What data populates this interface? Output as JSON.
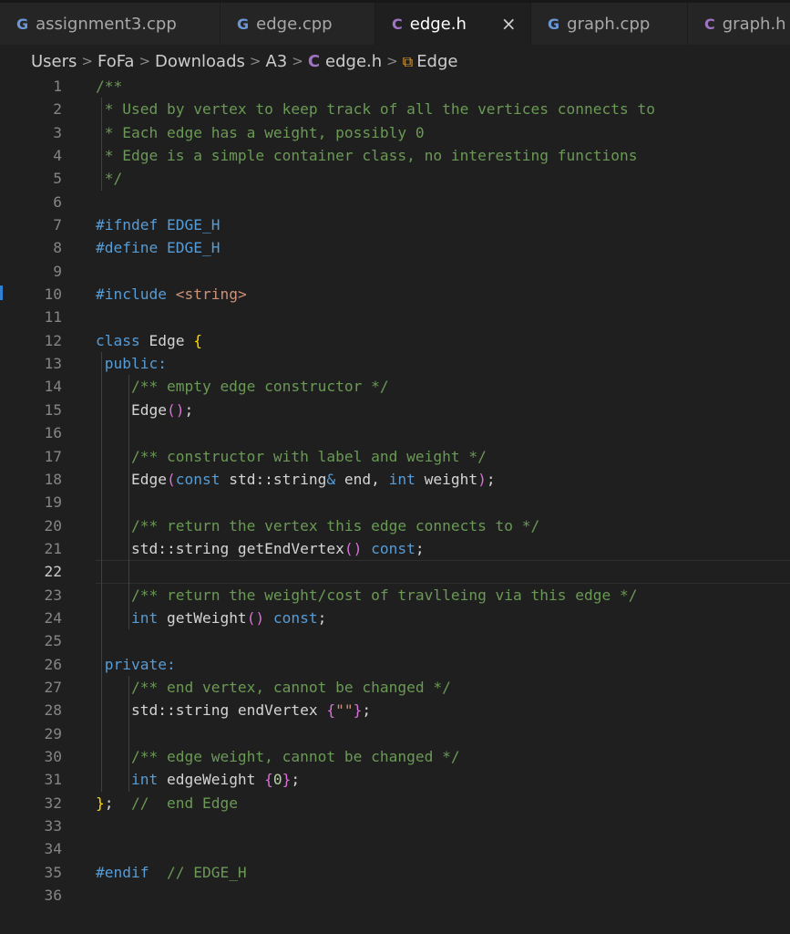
{
  "tabs": [
    {
      "icon": "G",
      "icon_kind": "cpp",
      "label": "assignment3.cpp",
      "active": false
    },
    {
      "icon": "G",
      "icon_kind": "cpp",
      "label": "edge.cpp",
      "active": false
    },
    {
      "icon": "C",
      "icon_kind": "h",
      "label": "edge.h",
      "active": true,
      "close": "×"
    },
    {
      "icon": "G",
      "icon_kind": "cpp",
      "label": "graph.cpp",
      "active": false
    },
    {
      "icon": "C",
      "icon_kind": "h",
      "label": "graph.h",
      "active": false
    }
  ],
  "breadcrumb": {
    "items": [
      "Users",
      "FoFa",
      "Downloads",
      "A3",
      "edge.h",
      "Edge"
    ],
    "sep": ">",
    "file_icon": "C",
    "class_icon": "⧉"
  },
  "editor": {
    "current_line": 22,
    "lines": [
      [
        [
          "k-com",
          "/**"
        ]
      ],
      [
        [
          "k-com",
          " * Used by vertex to keep track of all the vertices connects to"
        ]
      ],
      [
        [
          "k-com",
          " * Each edge has a weight, possibly 0"
        ]
      ],
      [
        [
          "k-com",
          " * Edge is a simple container class, no interesting functions"
        ]
      ],
      [
        [
          "k-com",
          " */"
        ]
      ],
      [],
      [
        [
          "k-pre",
          "#ifndef "
        ],
        [
          "k-mac",
          "EDGE_H"
        ]
      ],
      [
        [
          "k-pre",
          "#define "
        ],
        [
          "k-mac",
          "EDGE_H"
        ]
      ],
      [],
      [
        [
          "k-pre",
          "#include "
        ],
        [
          "k-str",
          "<string>"
        ]
      ],
      [],
      [
        [
          "k-kw",
          "class "
        ],
        [
          "k-txt",
          "Edge "
        ],
        [
          "k-br1",
          "{"
        ]
      ],
      [
        [
          "k-kw",
          " public:"
        ]
      ],
      [
        [
          "k-com",
          "    /** empty edge constructor */"
        ]
      ],
      [
        [
          "k-txt",
          "    Edge"
        ],
        [
          "k-br2",
          "()"
        ],
        [
          "k-txt",
          ";"
        ]
      ],
      [],
      [
        [
          "k-com",
          "    /** constructor with label and weight */"
        ]
      ],
      [
        [
          "k-txt",
          "    Edge"
        ],
        [
          "k-br2",
          "("
        ],
        [
          "k-kw",
          "const "
        ],
        [
          "k-txt",
          "std::string"
        ],
        [
          "k-ref",
          "&"
        ],
        [
          "k-txt",
          " end, "
        ],
        [
          "k-kw",
          "int "
        ],
        [
          "k-txt",
          "weight"
        ],
        [
          "k-br2",
          ")"
        ],
        [
          "k-txt",
          ";"
        ]
      ],
      [],
      [
        [
          "k-com",
          "    /** return the vertex this edge connects to */"
        ]
      ],
      [
        [
          "k-txt",
          "    std::string getEndVertex"
        ],
        [
          "k-br2",
          "()"
        ],
        [
          "k-kw",
          " const"
        ],
        [
          "k-txt",
          ";"
        ]
      ],
      [],
      [
        [
          "k-com",
          "    /** return the weight/cost of travlleing via this edge */"
        ]
      ],
      [
        [
          "k-kw",
          "    int "
        ],
        [
          "k-txt",
          "getWeight"
        ],
        [
          "k-br2",
          "()"
        ],
        [
          "k-kw",
          " const"
        ],
        [
          "k-txt",
          ";"
        ]
      ],
      [],
      [
        [
          "k-kw",
          " private:"
        ]
      ],
      [
        [
          "k-com",
          "    /** end vertex, cannot be changed */"
        ]
      ],
      [
        [
          "k-txt",
          "    std::string endVertex "
        ],
        [
          "k-br2",
          "{"
        ],
        [
          "k-str",
          "\"\""
        ],
        [
          "k-br2",
          "}"
        ],
        [
          "k-txt",
          ";"
        ]
      ],
      [],
      [
        [
          "k-com",
          "    /** edge weight, cannot be changed */"
        ]
      ],
      [
        [
          "k-kw",
          "    int "
        ],
        [
          "k-txt",
          "edgeWeight "
        ],
        [
          "k-br2",
          "{"
        ],
        [
          "k-num",
          "0"
        ],
        [
          "k-br2",
          "}"
        ],
        [
          "k-txt",
          ";"
        ]
      ],
      [
        [
          "k-br1",
          "}"
        ],
        [
          "k-txt",
          ";  "
        ],
        [
          "k-com",
          "//  end Edge"
        ]
      ],
      [],
      [],
      [
        [
          "k-pre",
          "#endif  "
        ],
        [
          "k-com",
          "// EDGE_H"
        ]
      ],
      []
    ]
  }
}
